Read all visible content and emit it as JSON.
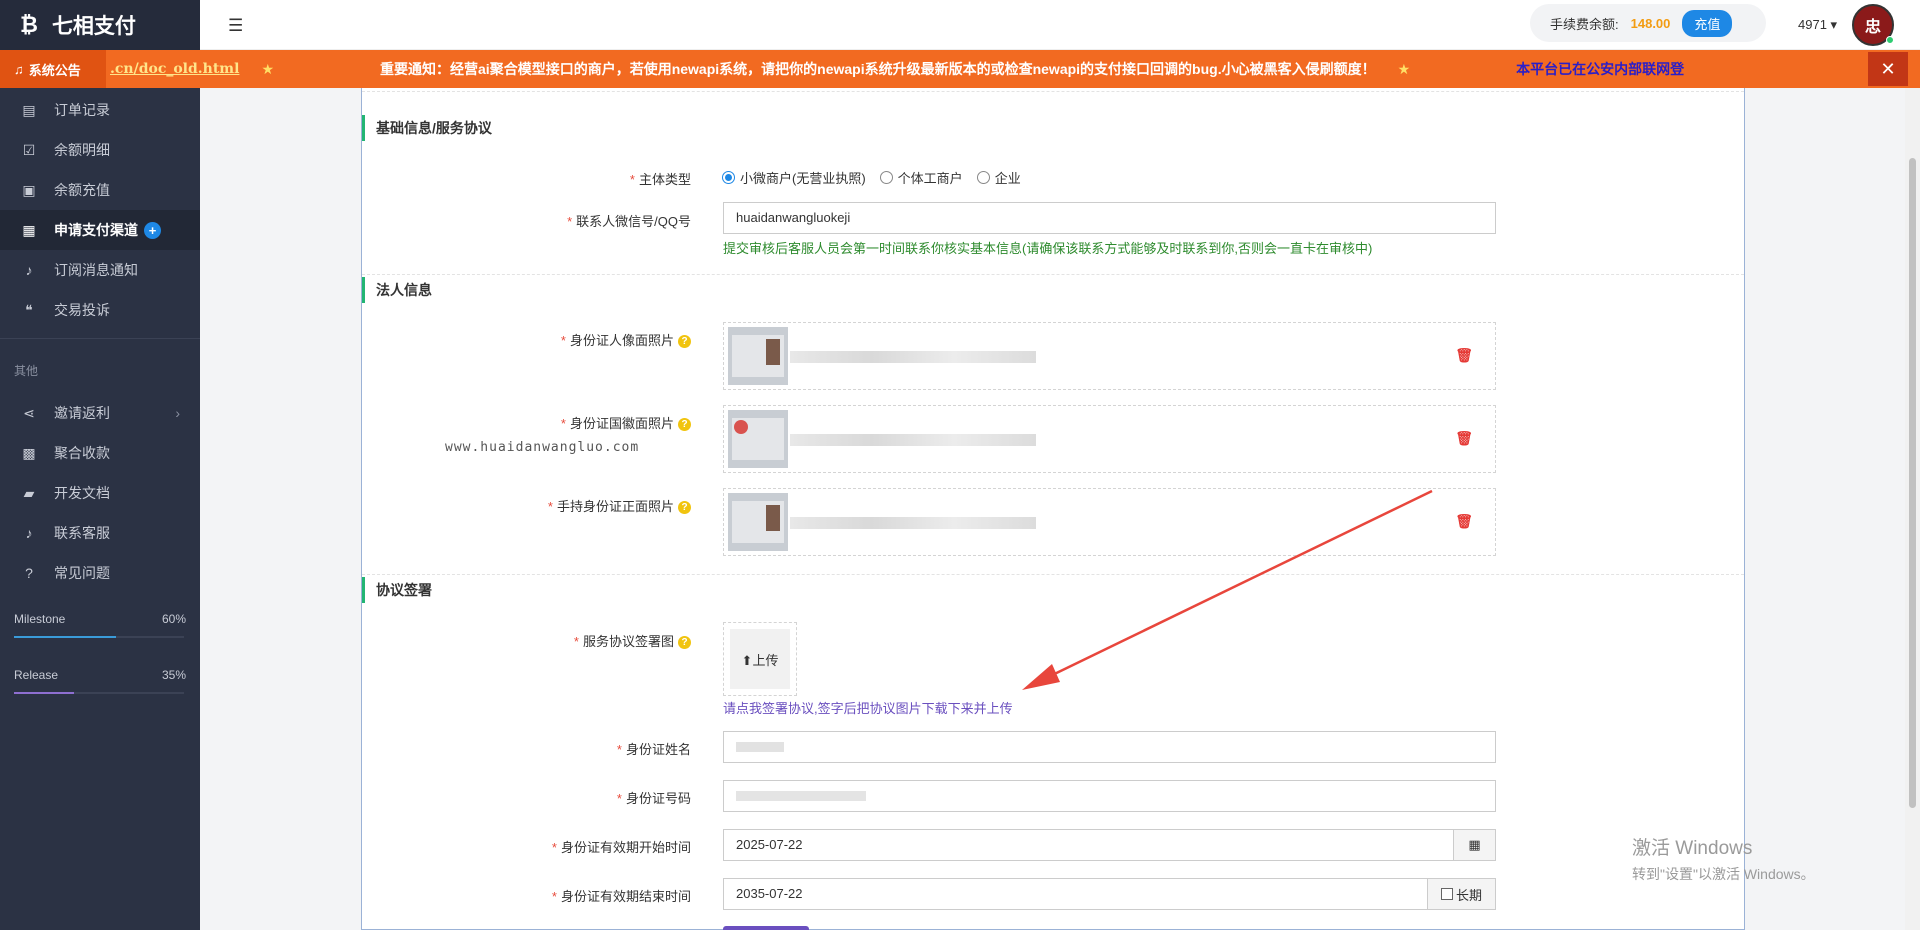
{
  "brand": {
    "logo": "₿",
    "name": "七相支付"
  },
  "topbar": {
    "balance_label": "手续费余额:",
    "balance_value": "148.00",
    "recharge": "充值",
    "user_id": "4971 ▾",
    "avatar_text": "忠"
  },
  "notice": {
    "title": "系统公告",
    "link": ".cn/doc_old.html",
    "message": "重要通知：经营ai聚合模型接口的商户，若使用newapi系统，请把你的newapi系统升级最新版本的或检查newapi的支付接口回调的bug.小心被黑客入侵刷额度！",
    "tail": "本平台已在公安内部联网登"
  },
  "sidebar": {
    "items": [
      {
        "label": "订单记录",
        "icon": "list-icon"
      },
      {
        "label": "余额明细",
        "icon": "calendar-check-icon"
      },
      {
        "label": "余额充值",
        "icon": "money-icon"
      },
      {
        "label": "申请支付渠道",
        "icon": "clipboard-icon",
        "badge": "+"
      },
      {
        "label": "订阅消息通知",
        "icon": "bell-icon"
      },
      {
        "label": "交易投诉",
        "icon": "chat-icon"
      }
    ],
    "section_other": "其他",
    "other_items": [
      {
        "label": "邀请返利",
        "icon": "share-icon",
        "chevron": "›"
      },
      {
        "label": "聚合收款",
        "icon": "grid-icon"
      },
      {
        "label": "开发文档",
        "icon": "book-icon"
      },
      {
        "label": "联系客服",
        "icon": "bell-icon"
      },
      {
        "label": "常见问题",
        "icon": "question-icon"
      }
    ],
    "progress": [
      {
        "name": "Milestone",
        "percent": "60%",
        "value": 0.6,
        "color": "#3a9bd9"
      },
      {
        "name": "Release",
        "percent": "35%",
        "value": 0.35,
        "color": "#8e6fd1"
      }
    ]
  },
  "form": {
    "section_basic": "基础信息/服务协议",
    "subject_type_label": "主体类型",
    "subject_options": [
      "小微商户(无营业执照)",
      "个体工商户",
      "企业"
    ],
    "contact_label": "联系人微信号/QQ号",
    "contact_value": "huaidanwangluokeji",
    "contact_hint": "提交审核后客服人员会第一时间联系你核实基本信息(请确保该联系方式能够及时联系到你,否则会一直卡在审核中)",
    "section_legal": "法人信息",
    "id_front_label": "身份证人像面照片",
    "id_back_label": "身份证国徽面照片",
    "id_hold_label": "手持身份证正面照片",
    "watermark": "www.huaidanwangluo.com",
    "section_agreement": "协议签署",
    "agreement_label": "服务协议签署图",
    "upload_button": "⬆上传",
    "agreement_hint": "请点我签署协议,签字后把协议图片下载下来并上传",
    "id_name_label": "身份证姓名",
    "id_number_label": "身份证号码",
    "id_start_label": "身份证有效期开始时间",
    "id_start_value": "2025-07-22",
    "id_end_label": "身份证有效期结束时间",
    "id_end_value": "2035-07-22",
    "long_term": "长期"
  },
  "windows": {
    "line1": "激活 Windows",
    "line2": "转到\"设置\"以激活 Windows。"
  }
}
